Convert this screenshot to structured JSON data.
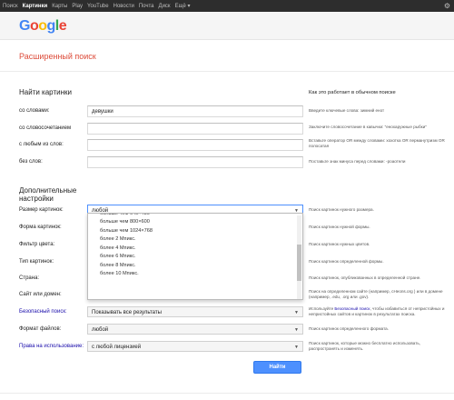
{
  "topbar": {
    "items": [
      "Поиск",
      "Картинки",
      "Карты",
      "Play",
      "YouTube",
      "Новости",
      "Почта",
      "Диск",
      "Ещё ▾"
    ],
    "active_index": 1
  },
  "logo": {
    "letters": [
      "G",
      "o",
      "o",
      "g",
      "l",
      "e"
    ]
  },
  "page_title": "Расширенный поиск",
  "find_section": {
    "title": "Найти картинки",
    "right_title": "Как это работает в обычном поиске",
    "rows": [
      {
        "label": "со словами:",
        "value": "девушки",
        "hint": "Введите ключевые слова: зимний енот"
      },
      {
        "label": "со словосочетанием",
        "value": "",
        "hint": "Заключите словосочетание в кавычки: \"енохаружные рыбки\""
      },
      {
        "label": "с любым из слов:",
        "value": "",
        "hint": "Вставьте оператор OR между словами: хохотка OR перманутризм OR полосатая"
      },
      {
        "label": "без слов:",
        "value": "",
        "hint": "Поставьте знак минуса перед словами: -роаотели"
      }
    ]
  },
  "extra_section": {
    "title": "Дополнительные настройки",
    "rows": [
      {
        "label": "Размер картинок:",
        "value": "любой",
        "hint": "Поиск картинок нужного размера.",
        "blue": false
      },
      {
        "label": "Форма картинок:",
        "value": "",
        "hint": "Поиск картинок нужной формы.",
        "blue": false
      },
      {
        "label": "Фильтр цвета:",
        "value": "",
        "hint": "Поиск картинок нужных цветов.",
        "blue": false
      },
      {
        "label": "Тип картинок:",
        "value": "",
        "hint": "Поиск картинок определенной формы.",
        "blue": false
      },
      {
        "label": "Страна:",
        "value": "",
        "hint": "Поиск картинок, опубликованных в определенной стране.",
        "blue": false
      },
      {
        "label": "Сайт или домен:",
        "value": "",
        "hint": "Поиск на определенном сайте (например, cHeons.org ) или в домене (например, .edu, .org или .gov).",
        "blue": false
      },
      {
        "label": "Безопасный поиск:",
        "value": "Показывать все результаты",
        "hint_pre": "Используйте ",
        "hint_link": "Безопасный поиск",
        "hint_post": ", чтобы избавиться от непристойных и непристойных сайтов и картинок в результатах поиска.",
        "blue": true
      },
      {
        "label": "Формат файлов:",
        "value": "любой",
        "hint": "Поиск картинок определенного формата.",
        "blue": false
      },
      {
        "label": "Права на использование:",
        "value": "с любой лицензией",
        "hint": "Поиск картинок, которые можно бесплатно использовать, распространять и изменять.",
        "blue": true
      }
    ]
  },
  "dropdown": {
    "options": [
      "больше чем 640×480",
      "больше чем 800×600",
      "больше чем 1024×768",
      "более 2 Мпикс.",
      "более 4 Мпикс.",
      "более 6 Мпикс.",
      "более 8 Мпикс.",
      "более 10 Мпикс."
    ]
  },
  "submit_label": "Найти"
}
